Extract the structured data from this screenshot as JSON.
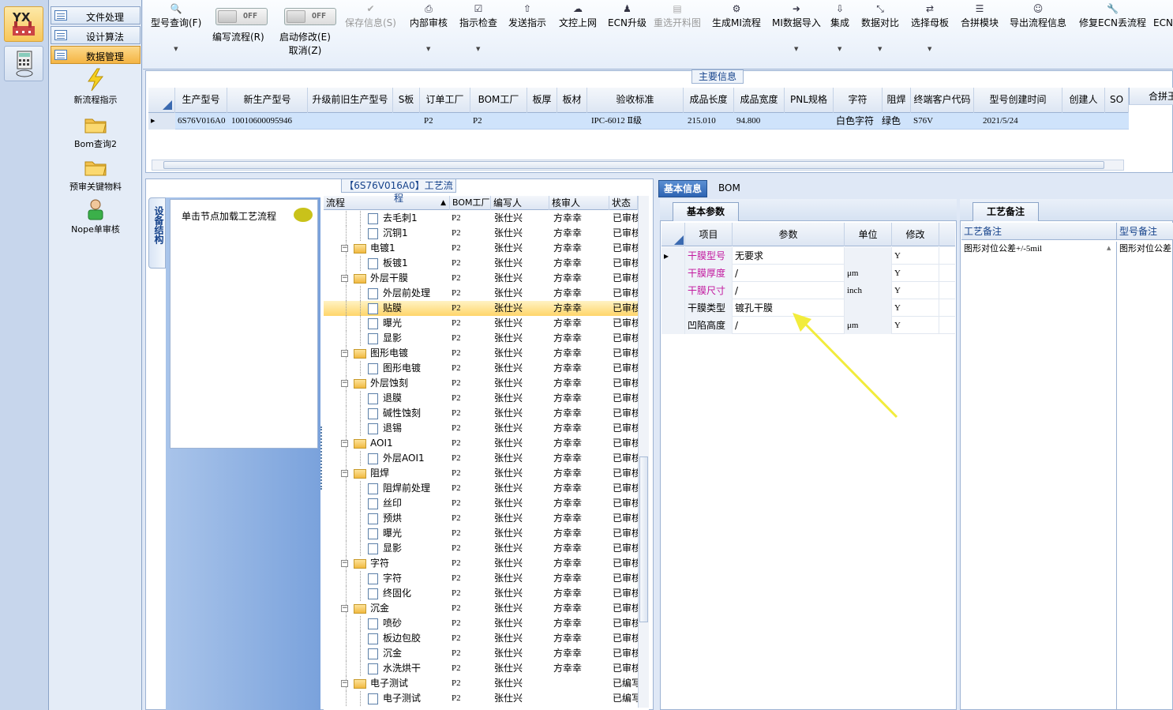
{
  "colors": {
    "accent": "#2e64b3",
    "selected_row": "#cfe3fb",
    "highlight": "#ffd56a",
    "magenta_label": "#c2189e"
  },
  "left_strip": {
    "app_badge": "YX"
  },
  "left_nav": {
    "items": [
      {
        "label": "文件处理"
      },
      {
        "label": "设计算法"
      },
      {
        "label": "数据管理"
      }
    ],
    "shortcuts": [
      {
        "label": "新流程指示",
        "icon": "lightning-icon"
      },
      {
        "label": "Bom查询2",
        "icon": "folder-icon"
      },
      {
        "label": "预审关键物料",
        "icon": "folder-icon"
      },
      {
        "label": "Nope单审核",
        "icon": "user-icon"
      }
    ]
  },
  "toolbar": {
    "query": "型号查询(F)",
    "toggle1_state": "OFF",
    "toggle1_label": "编写流程(R)",
    "toggle2_state": "OFF",
    "toggle2_label": "启动修改(E)",
    "toggle2_sub": "取消(Z)",
    "save": "保存信息(S)",
    "internal_review": "内部审核",
    "check": "指示检查",
    "send": "发送指示",
    "upload": "文控上网",
    "ecn_upgrade": "ECN升级",
    "reselect": "重选开料图",
    "gen_mi": "生成MI流程",
    "mi_import": "MI数据导入",
    "integrate": "集成",
    "compare": "数据对比",
    "select_master": "选择母板",
    "merge": "合拼模块",
    "export_flow": "导出流程信息",
    "fix_ecn": "修复ECN丢流程",
    "ecn_cut": "ECN自"
  },
  "main_info": {
    "title": "主要信息",
    "columns": [
      "生产型号",
      "新生产型号",
      "升级前旧生产型号",
      "S板",
      "订单工厂",
      "BOM工厂",
      "板厚",
      "板材",
      "验收标准",
      "成品长度",
      "成品宽度",
      "PNL规格",
      "字符",
      "阻焊",
      "终端客户代码",
      "型号创建时间",
      "创建人",
      "SO",
      "合拼王"
    ],
    "row": {
      "prod_model": "6S76V016A0",
      "new_prod_model": "10010600095946",
      "old_model": "",
      "s_board": "",
      "order_factory": "P2",
      "bom_factory": "P2",
      "thickness": "",
      "material": "",
      "standard": "IPC-6012 Ⅱ级",
      "length": "215.010",
      "width": "94.800",
      "pnl": "",
      "char": "白色字符",
      "solder": "绿色",
      "customer": "S76V",
      "created": "2021/5/24",
      "creator": ""
    }
  },
  "flow_panel": {
    "title": "【6S76V016A0】工艺流程",
    "side_tab": "设备结构",
    "hint": "单击节点加载工艺流程",
    "columns": [
      "流程",
      "BOM工厂",
      "编写人",
      "核审人",
      "状态"
    ],
    "rows": [
      {
        "name": "去毛刺1",
        "level": 2,
        "bom": "P2",
        "writer": "张仕兴",
        "reviewer": "方幸幸",
        "status": "已审核"
      },
      {
        "name": "沉铜1",
        "level": 2,
        "bom": "P2",
        "writer": "张仕兴",
        "reviewer": "方幸幸",
        "status": "已审核"
      },
      {
        "name": "电镀1",
        "level": 1,
        "bom": "P2",
        "writer": "张仕兴",
        "reviewer": "方幸幸",
        "status": "已审核"
      },
      {
        "name": "板镀1",
        "level": 2,
        "bom": "P2",
        "writer": "张仕兴",
        "reviewer": "方幸幸",
        "status": "已审核"
      },
      {
        "name": "外层干膜",
        "level": 1,
        "bom": "P2",
        "writer": "张仕兴",
        "reviewer": "方幸幸",
        "status": "已审核"
      },
      {
        "name": "外层前处理",
        "level": 2,
        "bom": "P2",
        "writer": "张仕兴",
        "reviewer": "方幸幸",
        "status": "已审核"
      },
      {
        "name": "贴膜",
        "level": 2,
        "bom": "P2",
        "writer": "张仕兴",
        "reviewer": "方幸幸",
        "status": "已审核",
        "selected": true
      },
      {
        "name": "曝光",
        "level": 2,
        "bom": "P2",
        "writer": "张仕兴",
        "reviewer": "方幸幸",
        "status": "已审核"
      },
      {
        "name": "显影",
        "level": 2,
        "bom": "P2",
        "writer": "张仕兴",
        "reviewer": "方幸幸",
        "status": "已审核"
      },
      {
        "name": "图形电镀",
        "level": 1,
        "bom": "P2",
        "writer": "张仕兴",
        "reviewer": "方幸幸",
        "status": "已审核"
      },
      {
        "name": "图形电镀",
        "level": 2,
        "bom": "P2",
        "writer": "张仕兴",
        "reviewer": "方幸幸",
        "status": "已审核"
      },
      {
        "name": "外层蚀刻",
        "level": 1,
        "bom": "P2",
        "writer": "张仕兴",
        "reviewer": "方幸幸",
        "status": "已审核"
      },
      {
        "name": "退膜",
        "level": 2,
        "bom": "P2",
        "writer": "张仕兴",
        "reviewer": "方幸幸",
        "status": "已审核"
      },
      {
        "name": "碱性蚀刻",
        "level": 2,
        "bom": "P2",
        "writer": "张仕兴",
        "reviewer": "方幸幸",
        "status": "已审核"
      },
      {
        "name": "退锡",
        "level": 2,
        "bom": "P2",
        "writer": "张仕兴",
        "reviewer": "方幸幸",
        "status": "已审核"
      },
      {
        "name": "AOI1",
        "level": 1,
        "bom": "P2",
        "writer": "张仕兴",
        "reviewer": "方幸幸",
        "status": "已审核"
      },
      {
        "name": "外层AOI1",
        "level": 2,
        "bom": "P2",
        "writer": "张仕兴",
        "reviewer": "方幸幸",
        "status": "已审核"
      },
      {
        "name": "阻焊",
        "level": 1,
        "bom": "P2",
        "writer": "张仕兴",
        "reviewer": "方幸幸",
        "status": "已审核"
      },
      {
        "name": "阻焊前处理",
        "level": 2,
        "bom": "P2",
        "writer": "张仕兴",
        "reviewer": "方幸幸",
        "status": "已审核"
      },
      {
        "name": "丝印",
        "level": 2,
        "bom": "P2",
        "writer": "张仕兴",
        "reviewer": "方幸幸",
        "status": "已审核"
      },
      {
        "name": "预烘",
        "level": 2,
        "bom": "P2",
        "writer": "张仕兴",
        "reviewer": "方幸幸",
        "status": "已审核"
      },
      {
        "name": "曝光",
        "level": 2,
        "bom": "P2",
        "writer": "张仕兴",
        "reviewer": "方幸幸",
        "status": "已审核"
      },
      {
        "name": "显影",
        "level": 2,
        "bom": "P2",
        "writer": "张仕兴",
        "reviewer": "方幸幸",
        "status": "已审核"
      },
      {
        "name": "字符",
        "level": 1,
        "bom": "P2",
        "writer": "张仕兴",
        "reviewer": "方幸幸",
        "status": "已审核"
      },
      {
        "name": "字符",
        "level": 2,
        "bom": "P2",
        "writer": "张仕兴",
        "reviewer": "方幸幸",
        "status": "已审核"
      },
      {
        "name": "终固化",
        "level": 2,
        "bom": "P2",
        "writer": "张仕兴",
        "reviewer": "方幸幸",
        "status": "已审核"
      },
      {
        "name": "沉金",
        "level": 1,
        "bom": "P2",
        "writer": "张仕兴",
        "reviewer": "方幸幸",
        "status": "已审核"
      },
      {
        "name": "喷砂",
        "level": 2,
        "bom": "P2",
        "writer": "张仕兴",
        "reviewer": "方幸幸",
        "status": "已审核"
      },
      {
        "name": "板边包胶",
        "level": 2,
        "bom": "P2",
        "writer": "张仕兴",
        "reviewer": "方幸幸",
        "status": "已审核"
      },
      {
        "name": "沉金",
        "level": 2,
        "bom": "P2",
        "writer": "张仕兴",
        "reviewer": "方幸幸",
        "status": "已审核"
      },
      {
        "name": "水洗烘干",
        "level": 2,
        "bom": "P2",
        "writer": "张仕兴",
        "reviewer": "方幸幸",
        "status": "已审核"
      },
      {
        "name": "电子测试",
        "level": 1,
        "bom": "P2",
        "writer": "张仕兴",
        "reviewer": "",
        "status": "已编写"
      },
      {
        "name": "电子测试",
        "level": 2,
        "bom": "P2",
        "writer": "张仕兴",
        "reviewer": "",
        "status": "已编写"
      }
    ]
  },
  "right_tabs": {
    "basic": "基本信息",
    "bom": "BOM"
  },
  "basic_params": {
    "tab": "基本参数",
    "columns": [
      "项目",
      "参数",
      "单位",
      "修改"
    ],
    "rows": [
      {
        "item": "干膜型号",
        "param": "无要求",
        "unit": "",
        "edit": "Y",
        "magenta": true
      },
      {
        "item": "干膜厚度",
        "param": "/",
        "unit": "μm",
        "edit": "Y",
        "magenta": true
      },
      {
        "item": "干膜尺寸",
        "param": "/",
        "unit": "inch",
        "edit": "Y",
        "magenta": true
      },
      {
        "item": "干膜类型",
        "param": "镀孔干膜",
        "unit": "",
        "edit": "Y",
        "magenta": false
      },
      {
        "item": "凹陷高度",
        "param": "/",
        "unit": "μm",
        "edit": "Y",
        "magenta": false
      }
    ]
  },
  "notes": {
    "tab": "工艺备注",
    "col1": "工艺备注",
    "col2": "型号备注",
    "val1": "图形对位公差+/-5mil",
    "val2": "图形对位公差"
  }
}
